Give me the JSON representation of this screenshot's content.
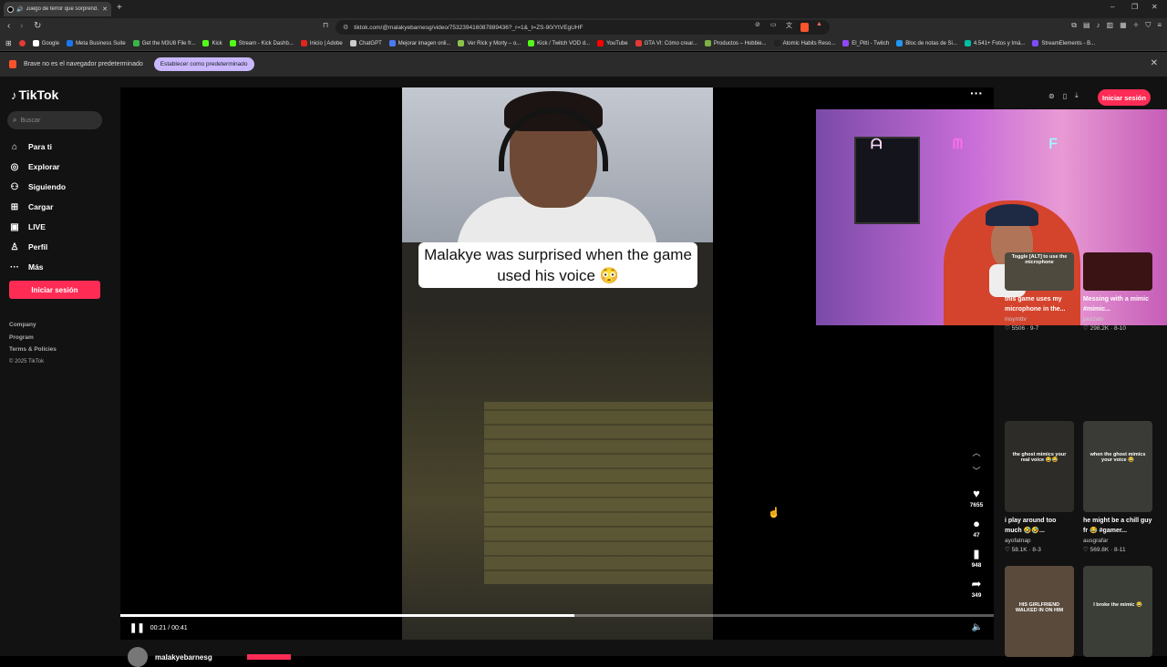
{
  "browser": {
    "tab_title": "Juego de terror que sorprend…",
    "url": "tiktok.com/@malakyebarnesg/video/753239416087889436?_r=1&_t=ZS-90/YtVEgUHF",
    "bookmarks": [
      {
        "label": "Google",
        "color": "#ffffff"
      },
      {
        "label": "Meta Business Suite",
        "color": "#1877f2"
      },
      {
        "label": "Get the M3U8 File fr...",
        "color": "#3bb54a"
      },
      {
        "label": "Kick",
        "color": "#53fc18"
      },
      {
        "label": "Stream - Kick Dashb...",
        "color": "#53fc18"
      },
      {
        "label": "Inicio | Adobe",
        "color": "#e1251b"
      },
      {
        "label": "ChatGPT",
        "color": "#cccccc"
      },
      {
        "label": "Mejorar imagen onli...",
        "color": "#4a7bf7"
      },
      {
        "label": "Ver Rick y Morty – o...",
        "color": "#8bc34a"
      },
      {
        "label": "Kick / Twitch VOD d...",
        "color": "#53fc18"
      },
      {
        "label": "YouTube",
        "color": "#ff0000"
      },
      {
        "label": "GTA VI: Cómo crear...",
        "color": "#e53935"
      },
      {
        "label": "Productos – Hobbie...",
        "color": "#7cb342"
      },
      {
        "label": "Atomic Habits Reso...",
        "color": "#222222"
      },
      {
        "label": "El_Pitti - Twitch",
        "color": "#9146ff"
      },
      {
        "label": "Bloc de notas de Si...",
        "color": "#2196f3"
      },
      {
        "label": "4.541+ Fotos y Imá...",
        "color": "#00bfa5"
      },
      {
        "label": "StreamElements - B...",
        "color": "#7c4dff"
      }
    ],
    "infobar_text": "Brave no es el navegador predeterminado",
    "infobar_button": "Establecer como predeterminado"
  },
  "sidebar": {
    "logo": "TikTok",
    "search_placeholder": "Buscar",
    "items": [
      {
        "label": "Para ti",
        "icon": "home-icon",
        "glyph": "⌂"
      },
      {
        "label": "Explorar",
        "icon": "compass-icon",
        "glyph": "◎"
      },
      {
        "label": "Siguiendo",
        "icon": "following-icon",
        "glyph": "⚇"
      },
      {
        "label": "Cargar",
        "icon": "upload-icon",
        "glyph": "⊞"
      },
      {
        "label": "LIVE",
        "icon": "live-icon",
        "glyph": "▣"
      },
      {
        "label": "Perfil",
        "icon": "profile-icon",
        "glyph": "♙"
      },
      {
        "label": "Más",
        "icon": "more-icon",
        "glyph": "···"
      }
    ],
    "login": "Iniciar sesión",
    "footer": [
      "Company",
      "Program",
      "Terms & Policies"
    ],
    "copyright": "© 2025 TikTok"
  },
  "video": {
    "caption": "Malakye was surprised when the game used his voice 😳",
    "time": "00:21 / 00:41",
    "progress": 0.52,
    "author": "malakyebarnesg",
    "likes": "7655",
    "comments": "47",
    "saves": "948",
    "shares": "349"
  },
  "header": {
    "login": "Iniciar sesión"
  },
  "recommended": [
    {
      "title": "this game uses my microphone in the...",
      "user": "insymttv",
      "likes": "5506",
      "date": "9-7",
      "overlay": "Toggle [ALT] to use the microphone",
      "bg": "#4e4a3e"
    },
    {
      "title": "Messing with a mimic #mimic...",
      "user": "pezzatv",
      "likes": "298.2K",
      "date": "8-10",
      "overlay": "",
      "bg": "#3a1414"
    },
    {
      "title": "i play around too much 🤣🤣...",
      "user": "ayofatnap",
      "likes": "58.1K",
      "date": "8-3",
      "overlay": "the ghost mimics your real voice 😂😂",
      "bg": "#2e2c28"
    },
    {
      "title": "he might be a chill guy fr 😂 #gamer...",
      "user": "ausgrafar",
      "likes": "569.8K",
      "date": "8-11",
      "overlay": "when the ghost mimics your voice 😂",
      "bg": "#3a3a36"
    },
    {
      "title": "",
      "user": "",
      "likes": "",
      "date": "",
      "overlay": "HIS GIRLFRIEND WALKED IN ON HIM",
      "bg": "#5a4a3c"
    },
    {
      "title": "",
      "user": "",
      "likes": "",
      "date": "",
      "overlay": "I broke the mimic 😂",
      "bg": "#3a3e36"
    }
  ]
}
